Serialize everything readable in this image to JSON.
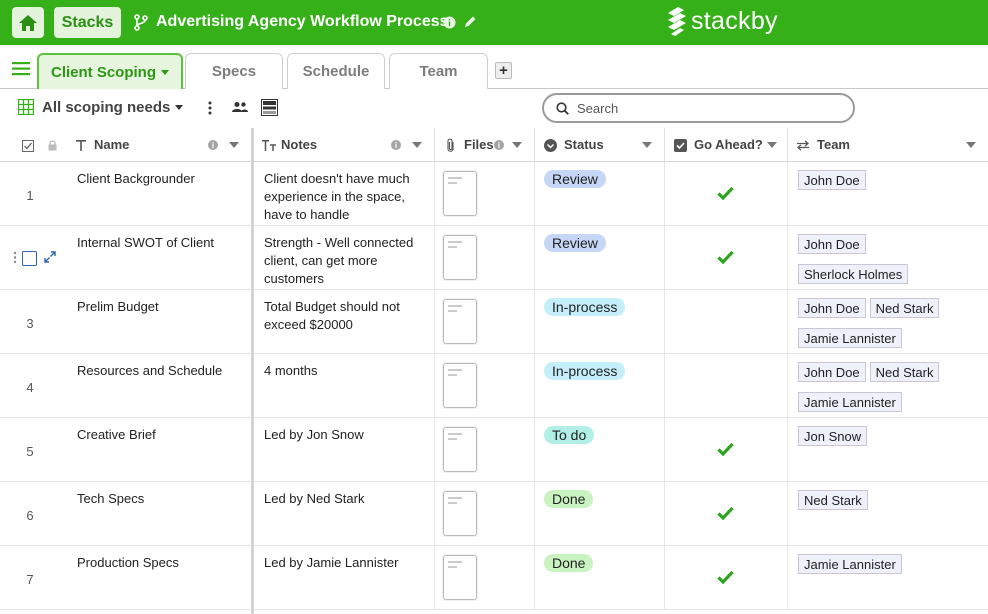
{
  "topbar": {
    "stacks_label": "Stacks",
    "title": "Advertising Agency Workflow Process",
    "logo_text": "stackby"
  },
  "tabs": [
    {
      "label": "Client Scoping",
      "active": true
    },
    {
      "label": "Specs",
      "active": false
    },
    {
      "label": "Schedule",
      "active": false
    },
    {
      "label": "Team",
      "active": false
    }
  ],
  "toolbar": {
    "view_name": "All scoping needs",
    "search_placeholder": "Search"
  },
  "columns": {
    "name": "Name",
    "notes": "Notes",
    "files": "Files",
    "status": "Status",
    "go_ahead": "Go Ahead?",
    "team": "Team"
  },
  "status_colors": {
    "Review": "#c5d6f7",
    "In-process": "#c4eef9",
    "To do": "#b2efe6",
    "Done": "#c9f4c2"
  },
  "rows": [
    {
      "num": "1",
      "name": "Client Backgrounder",
      "notes": "Client doesn't have much experience in the space, have to handle",
      "status": "Review",
      "go_ahead": true,
      "team": [
        "John Doe"
      ]
    },
    {
      "num": "2",
      "name": "Internal SWOT of Client",
      "notes": "Strength - Well connected client, can get more customers",
      "status": "Review",
      "go_ahead": true,
      "team": [
        "John Doe",
        "Sherlock Holmes"
      ]
    },
    {
      "num": "3",
      "name": "Prelim Budget",
      "notes": "Total Budget should not exceed $20000",
      "status": "In-process",
      "go_ahead": false,
      "team": [
        "John Doe",
        "Ned Stark",
        "Jamie Lannister"
      ]
    },
    {
      "num": "4",
      "name": "Resources and Schedule",
      "notes": "4 months",
      "status": "In-process",
      "go_ahead": false,
      "team": [
        "John Doe",
        "Ned Stark",
        "Jamie Lannister"
      ]
    },
    {
      "num": "5",
      "name": "Creative Brief",
      "notes": "Led by Jon Snow",
      "status": "To do",
      "go_ahead": true,
      "team": [
        "Jon Snow"
      ]
    },
    {
      "num": "6",
      "name": "Tech Specs",
      "notes": "Led by Ned Stark",
      "status": "Done",
      "go_ahead": true,
      "team": [
        "Ned Stark"
      ]
    },
    {
      "num": "7",
      "name": "Production Specs",
      "notes": "Led by Jamie Lannister",
      "status": "Done",
      "go_ahead": true,
      "team": [
        "Jamie Lannister"
      ]
    }
  ],
  "icons": [
    "home-icon",
    "branch-icon",
    "info-icon",
    "edit-icon",
    "stackby-logo-icon",
    "hamburger-icon",
    "add-tab-icon",
    "grid-view-icon",
    "more-icon",
    "people-icon",
    "row-height-icon",
    "search-icon",
    "checkbox-icon",
    "lock-icon",
    "text-icon",
    "long-text-icon",
    "attachment-icon",
    "status-icon",
    "check-icon",
    "link-icon"
  ]
}
